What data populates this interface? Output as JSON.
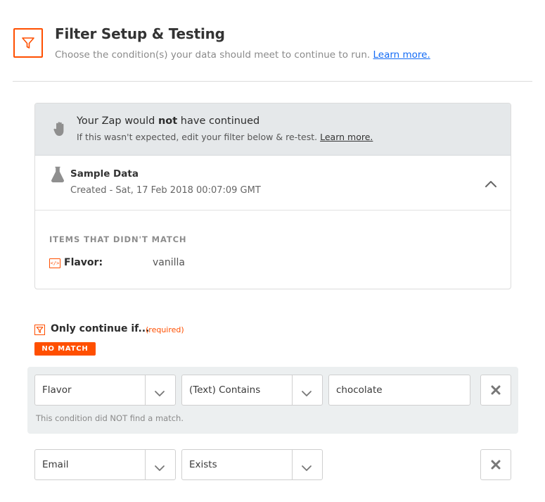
{
  "header": {
    "icon": "filter-icon",
    "title": "Filter Setup & Testing",
    "subtitle": "Choose the condition(s) your data should meet to continue to run.",
    "learn_more": "Learn more."
  },
  "result": {
    "icon": "hand-stop-icon",
    "title_before": "Your Zap would ",
    "title_bold": "not",
    "title_after": " have continued",
    "subtitle": "If this wasn't expected, edit your filter below & re-test.",
    "learn_more": "Learn more."
  },
  "sample": {
    "icon": "flask-icon",
    "title": "Sample Data",
    "created": "Created - Sat, 17 Feb 2018 00:07:09 GMT",
    "toggle_icon": "chevron-up-icon"
  },
  "unmatched": {
    "heading": "ITEMS THAT DIDN'T MATCH",
    "items": [
      {
        "icon": "code-icon",
        "icon_glyph": "</>",
        "key": "Flavor:",
        "value": "vanilla"
      }
    ]
  },
  "filter": {
    "label": "Only continue if...",
    "required": "(required)",
    "status_badge": "NO MATCH",
    "status_color": "#ff4f00",
    "conditions": [
      {
        "field": "Flavor",
        "operator": "(Text) Contains",
        "value": "chocolate",
        "note": "This condition did NOT find a match."
      },
      {
        "field": "Email",
        "operator": "Exists"
      }
    ]
  },
  "colors": {
    "accent": "#ff4f00",
    "link": "#136bf5",
    "panel_gray": "#e5e8ea"
  }
}
